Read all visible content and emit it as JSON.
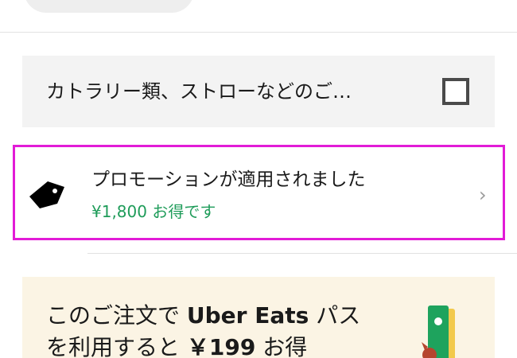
{
  "cutlery": {
    "label": "カトラリー類、ストローなどのご…",
    "checked": false
  },
  "promotion": {
    "icon": "tag-icon",
    "title": "プロモーションが適用されました",
    "savings": "¥1,800 お得です",
    "chevron": "›",
    "highlight_color": "#e21bd7",
    "savings_color": "#1f9c5a"
  },
  "uber_pass": {
    "line1_prefix": "このご注文で ",
    "line1_brand": "Uber Eats",
    "line1_suffix": " パス",
    "line2_prefix": "を利用すると ",
    "line2_price": "￥199",
    "line2_suffix": " お得",
    "icon": "pass-ticket-icon",
    "background": "#fbf4e4"
  }
}
